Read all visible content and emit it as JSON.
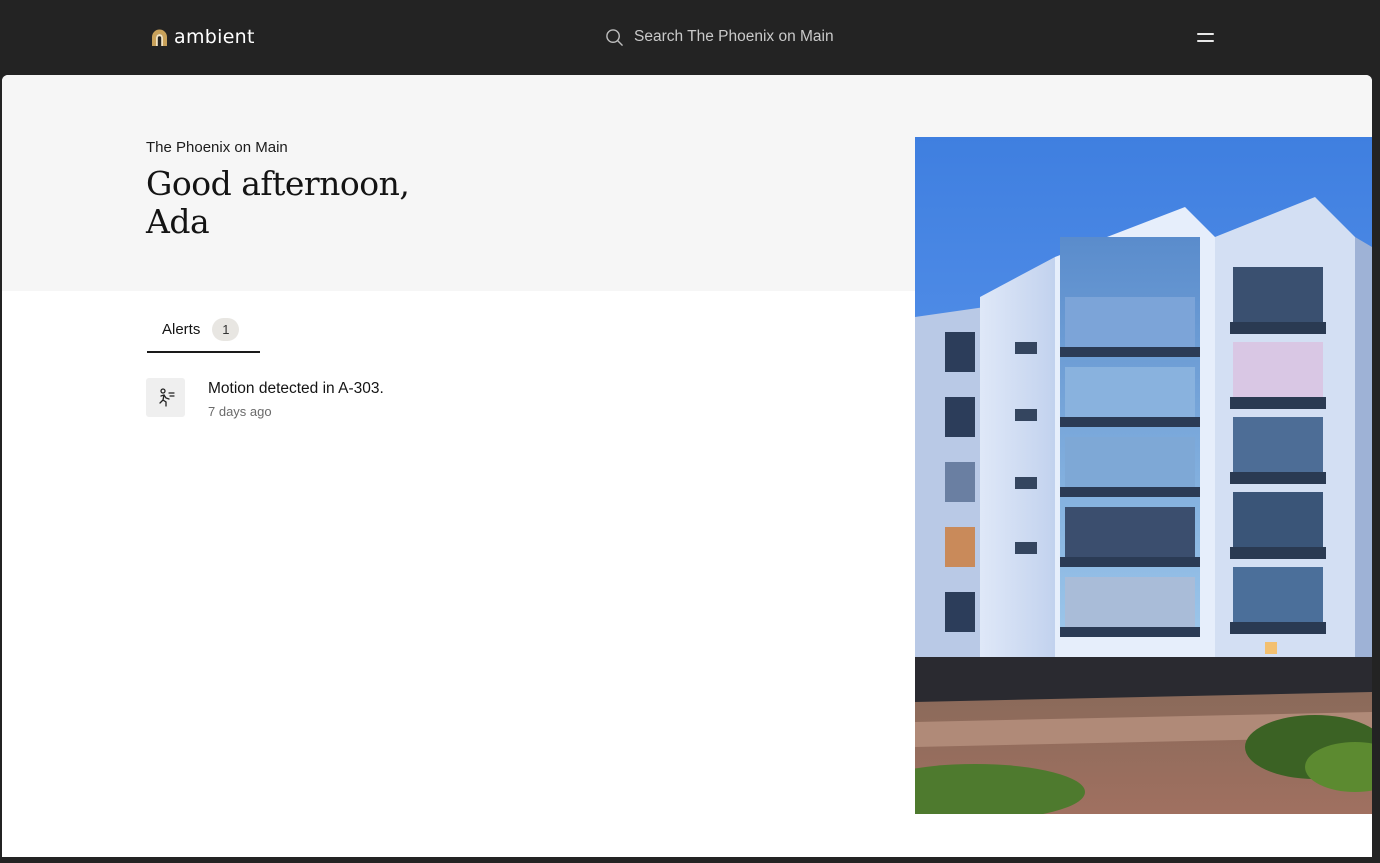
{
  "topbar": {
    "brand": "ambient",
    "brand_color": "#c8a15a",
    "search_placeholder": "Search The Phoenix on Main",
    "icons": [
      "logo-arch-icon",
      "search-icon",
      "menu-icon"
    ]
  },
  "hero": {
    "property_name": "The Phoenix on Main",
    "greeting_line1": "Good afternoon,",
    "greeting_line2": "Ada"
  },
  "tabs": [
    {
      "label": "Alerts",
      "count": "1",
      "active": true
    }
  ],
  "alerts": [
    {
      "icon": "running-person-icon",
      "title": "Motion detected in A-303.",
      "time": "7 days ago"
    }
  ]
}
